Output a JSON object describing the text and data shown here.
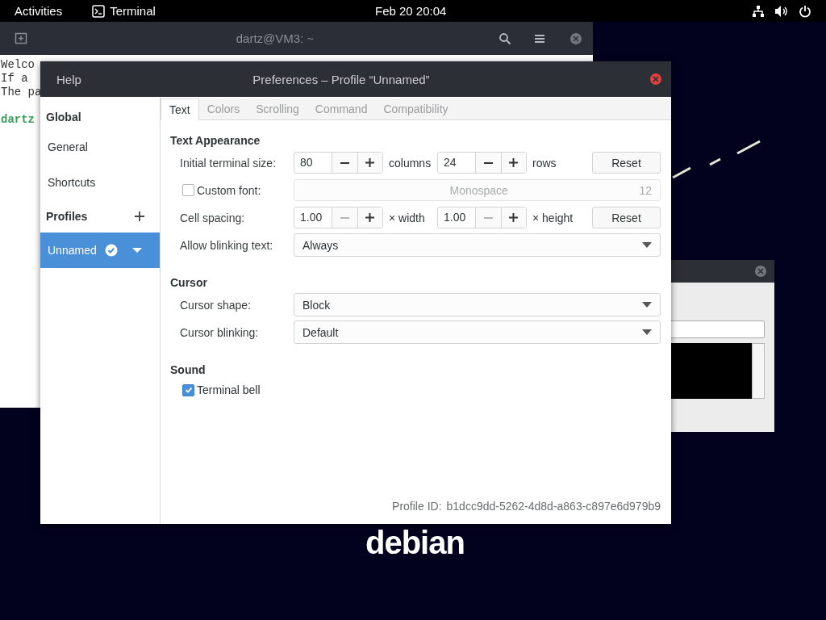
{
  "top_bar": {
    "activities": "Activities",
    "app": "Terminal",
    "clock": "Feb 20  20:04"
  },
  "terminal": {
    "title": "dartz@VM3: ~",
    "lines": [
      "Welco",
      "If a",
      "The pa"
    ],
    "prompt": "dartz"
  },
  "wallpaper": {
    "logo_text": "debian"
  },
  "dialog": {
    "menu": "Help",
    "title": "Preferences – Profile “Unnamed”"
  },
  "sidebar": {
    "global_heading": "Global",
    "items": [
      {
        "label": "General",
        "selected": false
      },
      {
        "label": "Shortcuts",
        "selected": false
      }
    ],
    "profiles_heading": "Profiles",
    "profiles": [
      {
        "label": "Unnamed",
        "selected": true,
        "default": true
      }
    ]
  },
  "tabs": [
    {
      "label": "Text",
      "selected": true
    },
    {
      "label": "Colors",
      "selected": false
    },
    {
      "label": "Scrolling",
      "selected": false
    },
    {
      "label": "Command",
      "selected": false
    },
    {
      "label": "Compatibility",
      "selected": false
    }
  ],
  "sections": [
    {
      "heading": "Text Appearance",
      "rows": [
        {
          "kind": "spin_pair",
          "label": "Initial terminal size:",
          "spins": [
            {
              "value": "80",
              "unit": "columns",
              "minus_disabled": false
            },
            {
              "value": "24",
              "unit": "rows",
              "minus_disabled": false
            }
          ],
          "button": "Reset"
        },
        {
          "kind": "font",
          "label": "Custom font:",
          "checked": false,
          "font": "Monospace",
          "size": "12",
          "disabled": true
        },
        {
          "kind": "spin_pair",
          "label": "Cell spacing:",
          "spins": [
            {
              "value": "1.00",
              "unit": "× width",
              "minus_disabled": true
            },
            {
              "value": "1.00",
              "unit": "× height",
              "minus_disabled": true
            }
          ],
          "button": "Reset"
        },
        {
          "kind": "combo",
          "label": "Allow blinking text:",
          "value": "Always"
        }
      ]
    },
    {
      "heading": "Cursor",
      "rows": [
        {
          "kind": "combo",
          "label": "Cursor shape:",
          "value": "Block"
        },
        {
          "kind": "combo",
          "label": "Cursor blinking:",
          "value": "Default"
        }
      ]
    },
    {
      "heading": "Sound",
      "rows": [
        {
          "kind": "check",
          "label": "Terminal bell",
          "checked": true
        }
      ]
    }
  ],
  "footer": {
    "label": "Profile ID:",
    "value": "b1dcc9dd-5262-4d8d-a863-c897e6d979b9"
  }
}
